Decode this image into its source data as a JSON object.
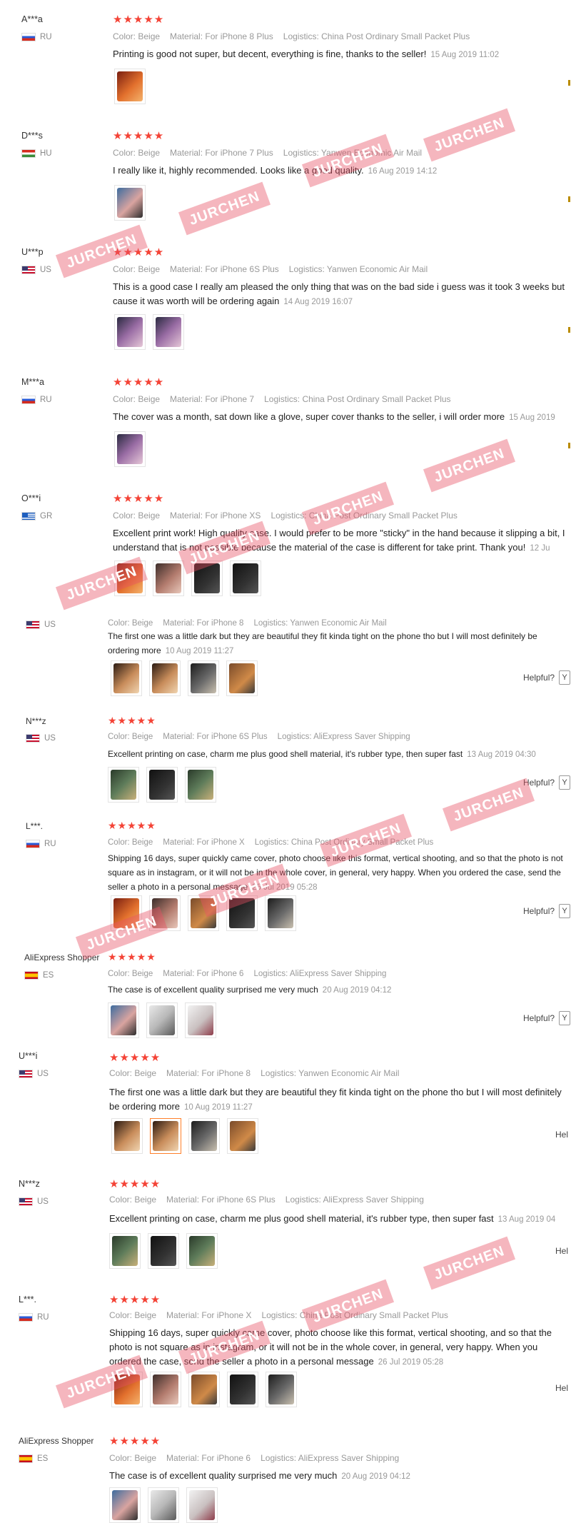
{
  "watermark": "JURCHEN",
  "helpful_label": "Helpful?",
  "helpful_label_cut": "Hel",
  "helpful_btn": "Y",
  "reviews": [
    {
      "user": "A***a",
      "country": "RU",
      "color": "Color: Beige",
      "material": "Material: For iPhone 8 Plus",
      "logistics": "Logistics: China Post Ordinary Small Packet Plus",
      "text": "Printing is good not super, but decent, everything is fine, thanks to the seller!",
      "date": "15 Aug 2019 11:02"
    },
    {
      "user": "D***s",
      "country": "HU",
      "color": "Color: Beige",
      "material": "Material: For iPhone 7 Plus",
      "logistics": "Logistics: Yanwen Economic Air Mail",
      "text": "I really like it, highly recommended. Looks like a good quality.",
      "date": "16 Aug 2019 14:12"
    },
    {
      "user": "U***p",
      "country": "US",
      "color": "Color: Beige",
      "material": "Material: For iPhone 6S Plus",
      "logistics": "Logistics: Yanwen Economic Air Mail",
      "text": "This is a good case I really am pleased the only thing that was on the bad side i guess was it took 3 weeks but cause it was worth will be ordering again",
      "date": "14 Aug 2019 16:07"
    },
    {
      "user": "M***a",
      "country": "RU",
      "color": "Color: Beige",
      "material": "Material: For iPhone 7",
      "logistics": "Logistics: China Post Ordinary Small Packet Plus",
      "text": "The cover was a month, sat down like a glove, super cover thanks to the seller, i will order more",
      "date": "15 Aug 2019"
    },
    {
      "user": "O***i",
      "country": "GR",
      "color": "Color: Beige",
      "material": "Material: For iPhone XS",
      "logistics": "Logistics: China Post Ordinary Small Packet Plus",
      "text": "Excellent print work! High quality case. I would prefer to be more \"sticky\" in the hand because it slipping a bit, I understand that is not possible because the material of the case is different for take print. Thank you!",
      "date": "12 Ju"
    },
    {
      "user": "",
      "country": "US",
      "color": "Color: Beige",
      "material": "Material: For iPhone 8",
      "logistics": "Logistics: Yanwen Economic Air Mail",
      "text": "The first one was a little dark but they are beautiful they fit kinda tight on the phone tho but I will most definitely be ordering more",
      "date": "10 Aug 2019 11:27"
    },
    {
      "user": "N***z",
      "country": "US",
      "color": "Color: Beige",
      "material": "Material: For iPhone 6S Plus",
      "logistics": "Logistics: AliExpress Saver Shipping",
      "text": "Excellent printing on case, charm me plus good shell material, it's rubber type, then super fast",
      "date": "13 Aug 2019 04:30"
    },
    {
      "user": "L***.",
      "country": "RU",
      "color": "Color: Beige",
      "material": "Material: For iPhone X",
      "logistics": "Logistics: China Post Ordinary Small Packet Plus",
      "text": "Shipping 16 days, super quickly came cover, photo choose like this format, vertical shooting, and so that the photo is not square as in instagram, or it will not be in the whole cover, in general, very happy. When you ordered the case, send the seller a photo in a personal message",
      "date": "26 Jul 2019 05:28"
    },
    {
      "user": "AliExpress Shopper",
      "country": "ES",
      "color": "Color: Beige",
      "material": "Material: For iPhone 6",
      "logistics": "Logistics: AliExpress Saver Shipping",
      "text": "The case is of excellent quality surprised me very much",
      "date": "20 Aug 2019 04:12"
    },
    {
      "user": "U***i",
      "country": "US",
      "color": "Color: Beige",
      "material": "Material: For iPhone 8",
      "logistics": "Logistics: Yanwen Economic Air Mail",
      "text": "The first one was a little dark but they are beautiful they fit kinda tight on the phone tho but I will most definitely be ordering more",
      "date": "10 Aug 2019 11:27"
    },
    {
      "user": "N***z",
      "country": "US",
      "color": "Color: Beige",
      "material": "Material: For iPhone 6S Plus",
      "logistics": "Logistics: AliExpress Saver Shipping",
      "text": "Excellent printing on case, charm me plus good shell material, it's rubber type, then super fast",
      "date": "13 Aug 2019 04"
    },
    {
      "user": "L***.",
      "country": "RU",
      "color": "Color: Beige",
      "material": "Material: For iPhone X",
      "logistics": "Logistics: China Post Ordinary Small Packet Plus",
      "text": "Shipping 16 days, super quickly came cover, photo choose like this format, vertical shooting, and so that the photo is not square as in instagram, or it will not be in the whole cover, in general, very happy. When you ordered the case, send the seller a photo in a personal message",
      "date": "26 Jul 2019 05:28"
    },
    {
      "user": "AliExpress Shopper",
      "country": "ES",
      "color": "Color: Beige",
      "material": "Material: For iPhone 6",
      "logistics": "Logistics: AliExpress Saver Shipping",
      "text": "The case is of excellent quality surprised me very much",
      "date": "20 Aug 2019 04:12"
    }
  ]
}
